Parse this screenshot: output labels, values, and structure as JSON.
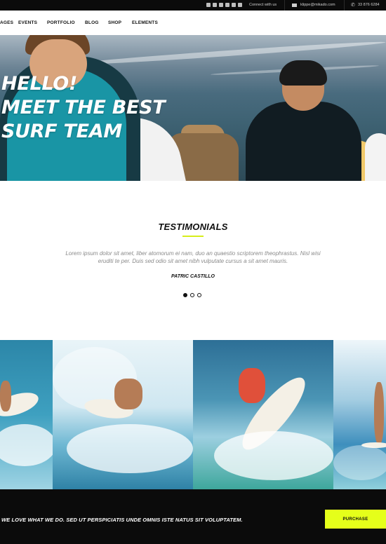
{
  "topbar": {
    "connect_text": "Connect with us",
    "email": "klippe@mikado.com",
    "phone": "33 876 6284",
    "social_icons": [
      "vimeo-icon",
      "linkedin-icon",
      "facebook-icon",
      "twitter-icon",
      "youtube-icon",
      "instagram-icon"
    ]
  },
  "nav": {
    "items": [
      "AGES",
      "EVENTS",
      "PORTFOLIO",
      "BLOG",
      "SHOP",
      "ELEMENTS"
    ]
  },
  "hero": {
    "title_line1": "HELLO!",
    "title_line2": "MEET THE BEST",
    "title_line3": "SURF TEAM"
  },
  "testimonials": {
    "heading": "TESTIMONIALS",
    "quote": "Lorem ipsum dolor sit amet, liber atomorum ei nam, duo an quaestio scriptorem theophrastus. Nisl wisi eruditi te per. Duis sed odio sit amet nibh vulputate cursus a sit amet mauris.",
    "author": "PATRIC CASTILLO",
    "active_slide": 1,
    "slides": 3
  },
  "footer": {
    "tagline": "WE LOVE WHAT WE DO. SED UT PERSPICIATIS UNDE OMNIS ISTE NATUS SIT VOLUPTATEM.",
    "purchase_label": "PURCHASE"
  },
  "colors": {
    "accent": "#e5ff1a",
    "dark": "#0b0b0b"
  }
}
